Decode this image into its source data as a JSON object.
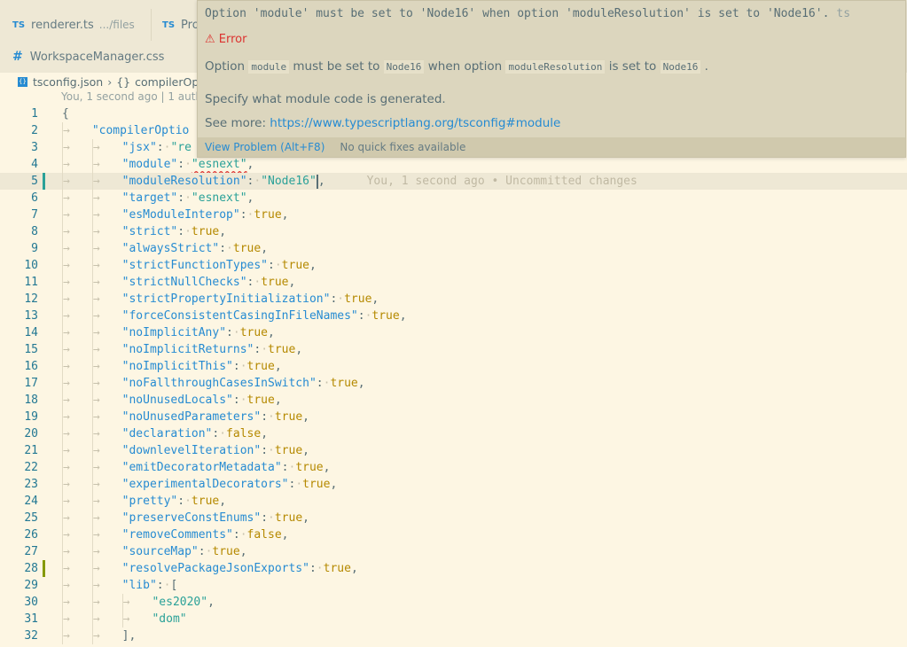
{
  "tabs": [
    {
      "icon": "TS",
      "name": "renderer.ts",
      "desc": ".../files"
    },
    {
      "icon": "TS",
      "name": "Pro",
      "desc": ""
    },
    {
      "icon": "#",
      "name": "WorkspaceManager.css",
      "desc": ""
    }
  ],
  "breadcrumb": {
    "file": "tsconfig.json",
    "symbol_icon": "{}",
    "symbol": "compilerOp"
  },
  "blame_header": "You, 1 second ago | 1 auth",
  "hover": {
    "message_pre": "Option 'module' must be set to 'Node16' when option 'moduleResolution' is set to 'Node16'.",
    "source": "ts",
    "severity": "⚠ Error",
    "detail": {
      "t1": "Option",
      "c1": "module",
      "t2": "must be set to",
      "c2": "Node16",
      "t3": "when option",
      "c3": "moduleResolution",
      "t4": "is set to",
      "c4": "Node16",
      "t5": "."
    },
    "description": "Specify what module code is generated.",
    "see_more_label": "See more:",
    "see_more_url": "https://www.typescriptlang.org/tsconfig#module",
    "view_problem": "View Problem (Alt+F8)",
    "no_fixes": "No quick fixes available"
  },
  "inline_blame": "You, 1 second ago • Uncommitted changes",
  "lines": [
    {
      "n": "1",
      "key": "",
      "val": "",
      "raw": "{"
    },
    {
      "n": "2",
      "key": "\"compilerOptio",
      "val": "",
      "raw": ""
    },
    {
      "n": "3",
      "key": "\"jsx\"",
      "val": "\"re",
      "raw": ""
    },
    {
      "n": "4",
      "key": "\"module\"",
      "val": "\"esnext\"",
      "raw": ""
    },
    {
      "n": "5",
      "key": "\"moduleResolution\"",
      "val": "\"Node16\"",
      "raw": ""
    },
    {
      "n": "6",
      "key": "\"target\"",
      "val": "\"esnext\"",
      "raw": ""
    },
    {
      "n": "7",
      "key": "\"esModuleInterop\"",
      "val": "true",
      "raw": ""
    },
    {
      "n": "8",
      "key": "\"strict\"",
      "val": "true",
      "raw": ""
    },
    {
      "n": "9",
      "key": "\"alwaysStrict\"",
      "val": "true",
      "raw": ""
    },
    {
      "n": "10",
      "key": "\"strictFunctionTypes\"",
      "val": "true",
      "raw": ""
    },
    {
      "n": "11",
      "key": "\"strictNullChecks\"",
      "val": "true",
      "raw": ""
    },
    {
      "n": "12",
      "key": "\"strictPropertyInitialization\"",
      "val": "true",
      "raw": ""
    },
    {
      "n": "13",
      "key": "\"forceConsistentCasingInFileNames\"",
      "val": "true",
      "raw": ""
    },
    {
      "n": "14",
      "key": "\"noImplicitAny\"",
      "val": "true",
      "raw": ""
    },
    {
      "n": "15",
      "key": "\"noImplicitReturns\"",
      "val": "true",
      "raw": ""
    },
    {
      "n": "16",
      "key": "\"noImplicitThis\"",
      "val": "true",
      "raw": ""
    },
    {
      "n": "17",
      "key": "\"noFallthroughCasesInSwitch\"",
      "val": "true",
      "raw": ""
    },
    {
      "n": "18",
      "key": "\"noUnusedLocals\"",
      "val": "true",
      "raw": ""
    },
    {
      "n": "19",
      "key": "\"noUnusedParameters\"",
      "val": "true",
      "raw": ""
    },
    {
      "n": "20",
      "key": "\"declaration\"",
      "val": "false",
      "raw": ""
    },
    {
      "n": "21",
      "key": "\"downlevelIteration\"",
      "val": "true",
      "raw": ""
    },
    {
      "n": "22",
      "key": "\"emitDecoratorMetadata\"",
      "val": "true",
      "raw": ""
    },
    {
      "n": "23",
      "key": "\"experimentalDecorators\"",
      "val": "true",
      "raw": ""
    },
    {
      "n": "24",
      "key": "\"pretty\"",
      "val": "true",
      "raw": ""
    },
    {
      "n": "25",
      "key": "\"preserveConstEnums\"",
      "val": "true",
      "raw": ""
    },
    {
      "n": "26",
      "key": "\"removeComments\"",
      "val": "false",
      "raw": ""
    },
    {
      "n": "27",
      "key": "\"sourceMap\"",
      "val": "true",
      "raw": ""
    },
    {
      "n": "28",
      "key": "\"resolvePackageJsonExports\"",
      "val": "true",
      "raw": ""
    },
    {
      "n": "29",
      "key": "\"lib\"",
      "val": "[",
      "raw": ""
    },
    {
      "n": "30",
      "key": "",
      "val": "",
      "raw": "\"es2020\","
    },
    {
      "n": "31",
      "key": "",
      "val": "",
      "raw": "\"dom\""
    },
    {
      "n": "32",
      "key": "",
      "val": "",
      "raw": "],"
    }
  ],
  "colors": {
    "modified": "#2aa198",
    "added": "#859900",
    "link": "#268bd2",
    "error": "#dc322f"
  }
}
